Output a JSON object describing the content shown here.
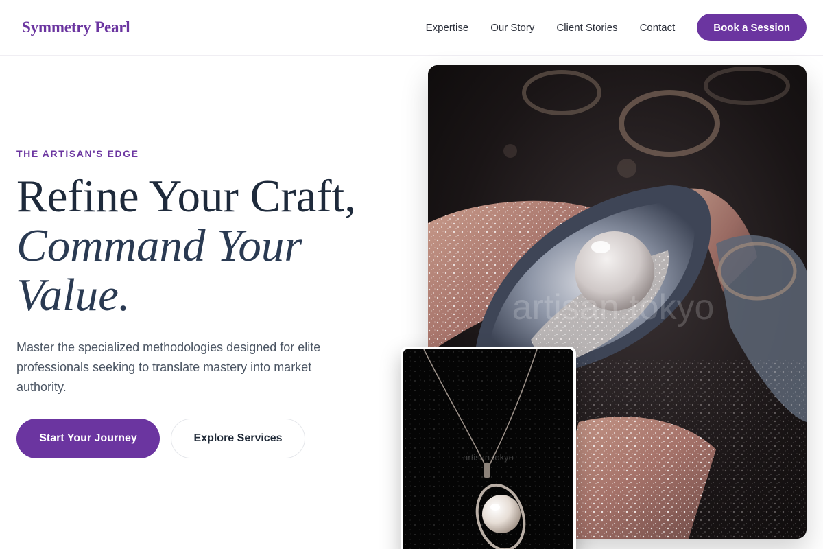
{
  "header": {
    "logo": "Symmetry Pearl",
    "nav": [
      {
        "label": "Expertise"
      },
      {
        "label": "Our Story"
      },
      {
        "label": "Client Stories"
      },
      {
        "label": "Contact"
      }
    ],
    "cta_label": "Book a Session"
  },
  "hero": {
    "eyebrow": "THE ARTISAN'S EDGE",
    "headline_line1": "Refine Your Craft,",
    "headline_line2": "Command Your",
    "headline_line3": "Value.",
    "subtext": "Master the specialized methodologies designed for elite professionals seeking to translate mastery into market authority.",
    "primary_button": "Start Your Journey",
    "secondary_button": "Explore Services"
  },
  "images": {
    "main_watermark": "artisan.tokyo",
    "secondary_watermark": "artisan.tokyo"
  },
  "colors": {
    "brand": "#6b35a0",
    "heading": "#1e2a3b",
    "body_text": "#4b5563"
  }
}
